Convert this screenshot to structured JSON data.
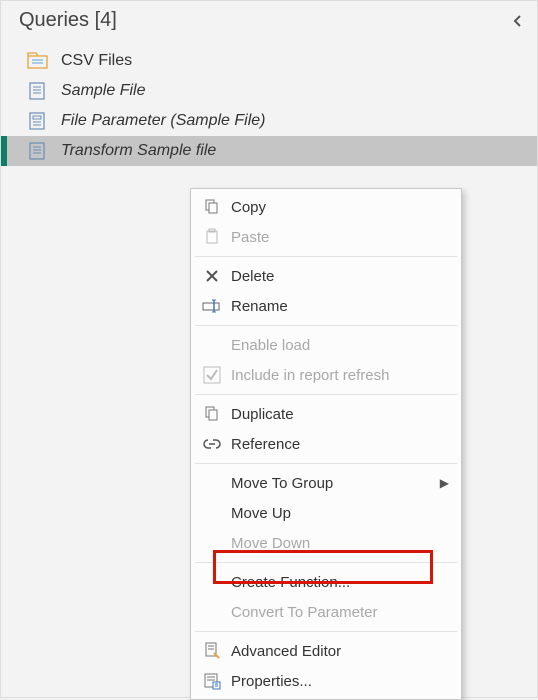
{
  "header": {
    "title": "Queries [4]"
  },
  "queries": [
    {
      "label": "CSV Files",
      "icon": "folder",
      "italic": false,
      "selected": false
    },
    {
      "label": "Sample File",
      "icon": "doc",
      "italic": true,
      "selected": false
    },
    {
      "label": "File Parameter (Sample File)",
      "icon": "param",
      "italic": true,
      "selected": false
    },
    {
      "label": "Transform Sample file",
      "icon": "doc",
      "italic": true,
      "selected": true
    }
  ],
  "menu": {
    "copy": "Copy",
    "paste": "Paste",
    "delete": "Delete",
    "rename": "Rename",
    "enable_load": "Enable load",
    "include_refresh": "Include in report refresh",
    "duplicate": "Duplicate",
    "reference": "Reference",
    "move_group": "Move To Group",
    "move_up": "Move Up",
    "move_down": "Move Down",
    "create_function": "Create Function...",
    "convert_param": "Convert To Parameter",
    "advanced_editor": "Advanced Editor",
    "properties": "Properties..."
  }
}
